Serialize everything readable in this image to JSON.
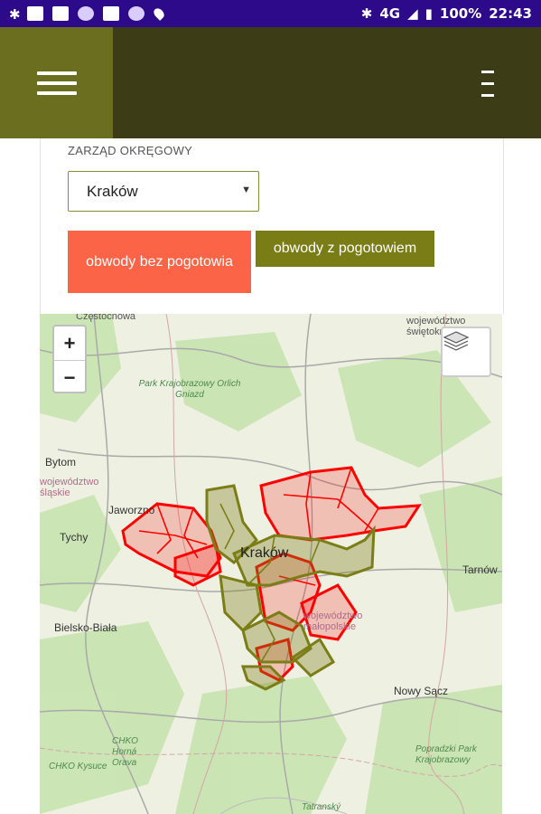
{
  "status_bar": {
    "network": "4G",
    "battery": "100%",
    "time": "22:43"
  },
  "filter": {
    "district_label": "ZARZĄD OKRĘGOWY",
    "district_value": "Kraków"
  },
  "buttons": {
    "without_emergency": "obwody bez pogotowia",
    "with_emergency": "obwody z pogotowiem"
  },
  "map": {
    "zoom_in": "+",
    "zoom_out": "−",
    "labels": {
      "czestochowa": "Częstochowa",
      "wojewodztwo_swieto": "województwo świętokrzyskie",
      "park_orlich": "Park Krajobrazowy Orlich Gniazd",
      "bytom": "Bytom",
      "wojewodztwo_slaskie": "województwo śląskie",
      "jaworzno": "Jaworzno",
      "tychy": "Tychy",
      "krakow": "Kraków",
      "tarnow": "Tarnów",
      "wojewodztwo_malopolskie": "województwo małopolskie",
      "bielsko": "Bielsko-Biała",
      "nowy_sacz": "Nowy Sącz",
      "chko_orava": "CHKO Horná Orava",
      "chko_kysuce": "CHKO Kysuce",
      "poprad_park": "Popradzki Park Krajobrazowy",
      "tatransky": "Tatranský"
    },
    "colors": {
      "without": "#ff0000",
      "with": "#7b7d16"
    }
  }
}
